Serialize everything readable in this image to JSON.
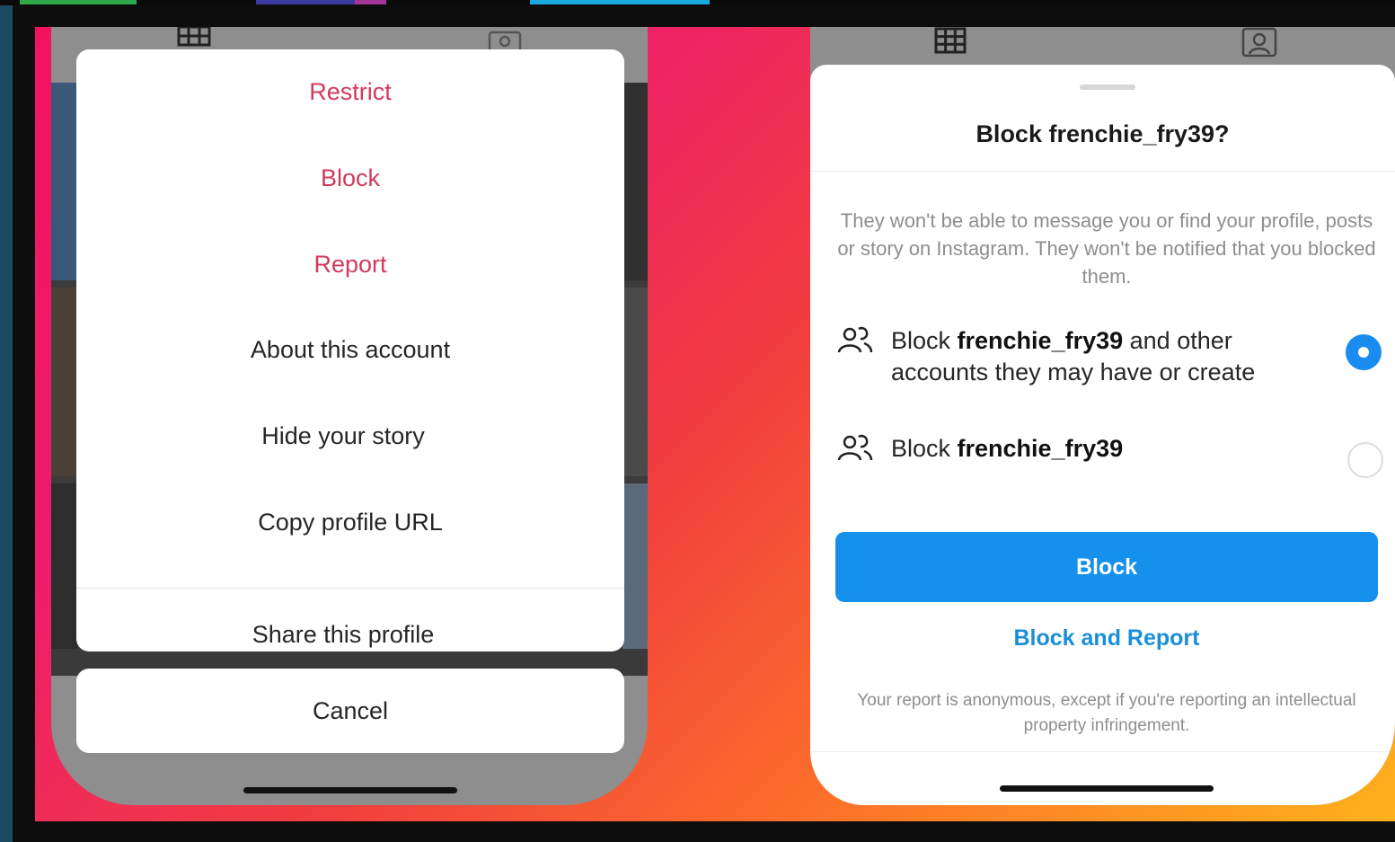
{
  "colors": {
    "danger_text": "#d23a5c",
    "primary_button": "#1590ec",
    "link_blue": "#1a8fd8",
    "muted_text": "#8e8e8e",
    "gradient": [
      "#f2135f",
      "#fc6f2a",
      "#ffb21c"
    ]
  },
  "left_phone": {
    "tab_icons": [
      "grid-icon",
      "tagged-icon"
    ],
    "menu": {
      "items": [
        {
          "label": "Restrict",
          "style": "danger"
        },
        {
          "label": "Block",
          "style": "danger"
        },
        {
          "label": "Report",
          "style": "danger"
        },
        {
          "label": "About this account",
          "style": "normal"
        },
        {
          "label": "Hide your story",
          "style": "normal"
        },
        {
          "label": "Copy profile URL",
          "style": "normal"
        },
        {
          "label": "Share this profile",
          "style": "normal"
        }
      ],
      "cancel_label": "Cancel"
    }
  },
  "right_phone": {
    "tab_icons": [
      "grid-icon",
      "tagged-user-icon"
    ],
    "dialog": {
      "title": "Block frenchie_fry39?",
      "description": "They won't be able to message you or find your profile, posts or story on Instagram. They won't be notified that you blocked them.",
      "options": [
        {
          "prefix": "Block ",
          "username": "frenchie_fry39",
          "suffix": " and other accounts they may have or create",
          "selected": true,
          "icon": "people-icon"
        },
        {
          "prefix": "Block ",
          "username": "frenchie_fry39",
          "suffix": "",
          "selected": false,
          "icon": "people-icon"
        }
      ],
      "block_button": "Block",
      "block_and_report": "Block and Report",
      "footnote": "Your report is anonymous, except if you're reporting an intellectual property infringement."
    }
  }
}
